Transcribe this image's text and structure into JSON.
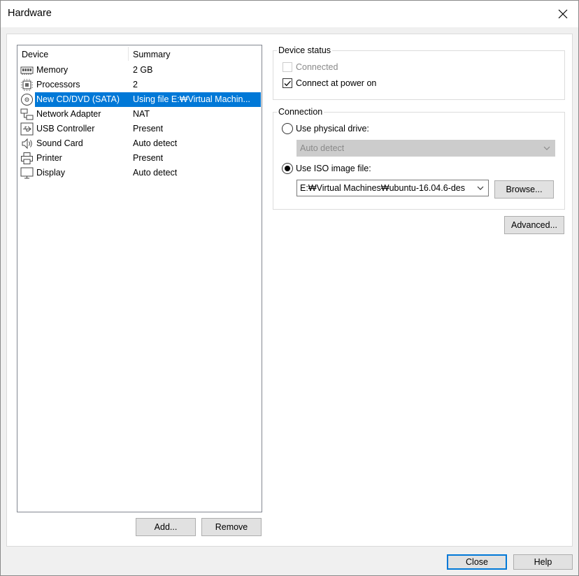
{
  "window": {
    "title": "Hardware",
    "close_icon": "close-icon"
  },
  "device_list": {
    "header_device": "Device",
    "header_summary": "Summary",
    "rows": [
      {
        "name": "Memory",
        "summary": "2 GB",
        "icon": "memory-icon"
      },
      {
        "name": "Processors",
        "summary": "2",
        "icon": "processor-icon"
      },
      {
        "name": "New CD/DVD (SATA)",
        "summary": "Using file E:₩Virtual Machin...",
        "icon": "cd-dvd-icon",
        "selected": true
      },
      {
        "name": "Network Adapter",
        "summary": "NAT",
        "icon": "network-adapter-icon"
      },
      {
        "name": "USB Controller",
        "summary": "Present",
        "icon": "usb-icon"
      },
      {
        "name": "Sound Card",
        "summary": "Auto detect",
        "icon": "sound-icon"
      },
      {
        "name": "Printer",
        "summary": "Present",
        "icon": "printer-icon"
      },
      {
        "name": "Display",
        "summary": "Auto detect",
        "icon": "display-icon"
      }
    ],
    "add_label": "Add...",
    "remove_label": "Remove"
  },
  "device_status": {
    "title": "Device status",
    "connected_label": "Connected",
    "connected_checked": false,
    "connect_at_power_on_label": "Connect at power on",
    "connect_at_power_on_checked": true
  },
  "connection": {
    "title": "Connection",
    "physical_drive_label": "Use physical drive:",
    "physical_drive_value": "Auto detect",
    "iso_label": "Use ISO image file:",
    "iso_value": "E:₩Virtual Machines₩ubuntu-16.04.6-des",
    "browse_label": "Browse...",
    "selected_option": "iso"
  },
  "advanced_label": "Advanced...",
  "footer": {
    "close_label": "Close",
    "help_label": "Help"
  },
  "colors": {
    "selection": "#0078d7",
    "button_face": "#e1e1e1",
    "window_bg": "#f0f0f0"
  }
}
